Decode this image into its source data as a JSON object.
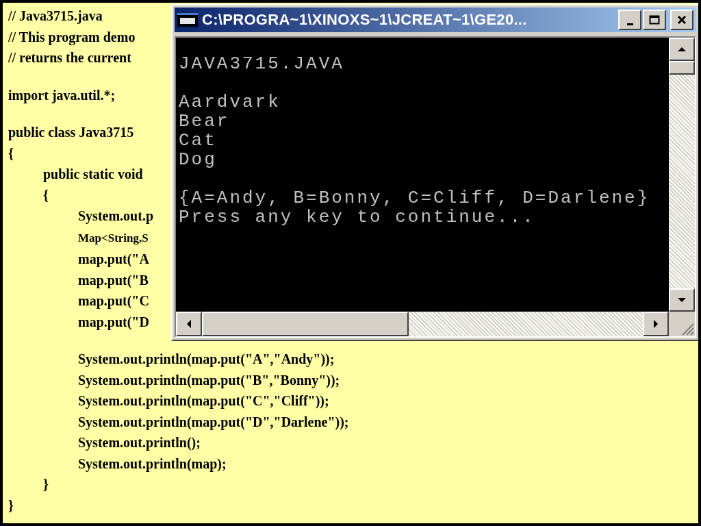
{
  "code": [
    {
      "kind": "text",
      "text": "// Java3715.java"
    },
    {
      "kind": "text",
      "text": "// This program demo"
    },
    {
      "kind": "text",
      "text": "// returns the current"
    },
    {
      "kind": "blank"
    },
    {
      "kind": "text",
      "text": "import java.util.*;"
    },
    {
      "kind": "blank"
    },
    {
      "kind": "text",
      "text": "public class Java3715"
    },
    {
      "kind": "text",
      "text": "{",
      "children": [
        {
          "kind": "text",
          "text": "public static void"
        },
        {
          "kind": "text",
          "text": "{",
          "children": [
            {
              "kind": "text",
              "text": "System.out.p"
            },
            {
              "kind": "text",
              "text": "Map<String,S",
              "small": true
            },
            {
              "kind": "text",
              "text": "map.put(\"A"
            },
            {
              "kind": "text",
              "text": "map.put(\"B"
            },
            {
              "kind": "text",
              "text": "map.put(\"C"
            },
            {
              "kind": "text",
              "text": "map.put(\"D"
            },
            {
              "kind": "blank"
            },
            {
              "kind": "text",
              "text": "System.out.println(map.put(\"A\",\"Andy\"));"
            },
            {
              "kind": "text",
              "text": "System.out.println(map.put(\"B\",\"Bonny\"));"
            },
            {
              "kind": "text",
              "text": "System.out.println(map.put(\"C\",\"Cliff\"));"
            },
            {
              "kind": "text",
              "text": "System.out.println(map.put(\"D\",\"Darlene\"));"
            },
            {
              "kind": "text",
              "text": "System.out.println();"
            },
            {
              "kind": "text",
              "text": "System.out.println(map);"
            }
          ]
        },
        {
          "kind": "text",
          "text": "}"
        }
      ]
    },
    {
      "kind": "text",
      "text": "}"
    }
  ],
  "console_window": {
    "title": "C:\\PROGRA~1\\XINOXS~1\\JCREAT~1\\GE20...",
    "lines": [
      {
        "kind": "text",
        "text": "JAVA3715.JAVA"
      },
      {
        "kind": "blank"
      },
      {
        "kind": "text",
        "text": "Aardvark"
      },
      {
        "kind": "text",
        "text": "Bear"
      },
      {
        "kind": "text",
        "text": "Cat"
      },
      {
        "kind": "text",
        "text": "Dog"
      },
      {
        "kind": "blank"
      },
      {
        "kind": "text",
        "text": "{A=Andy, B=Bonny, C=Cliff, D=Darlene}"
      },
      {
        "kind": "text",
        "text": "Press any key to continue..."
      }
    ]
  }
}
